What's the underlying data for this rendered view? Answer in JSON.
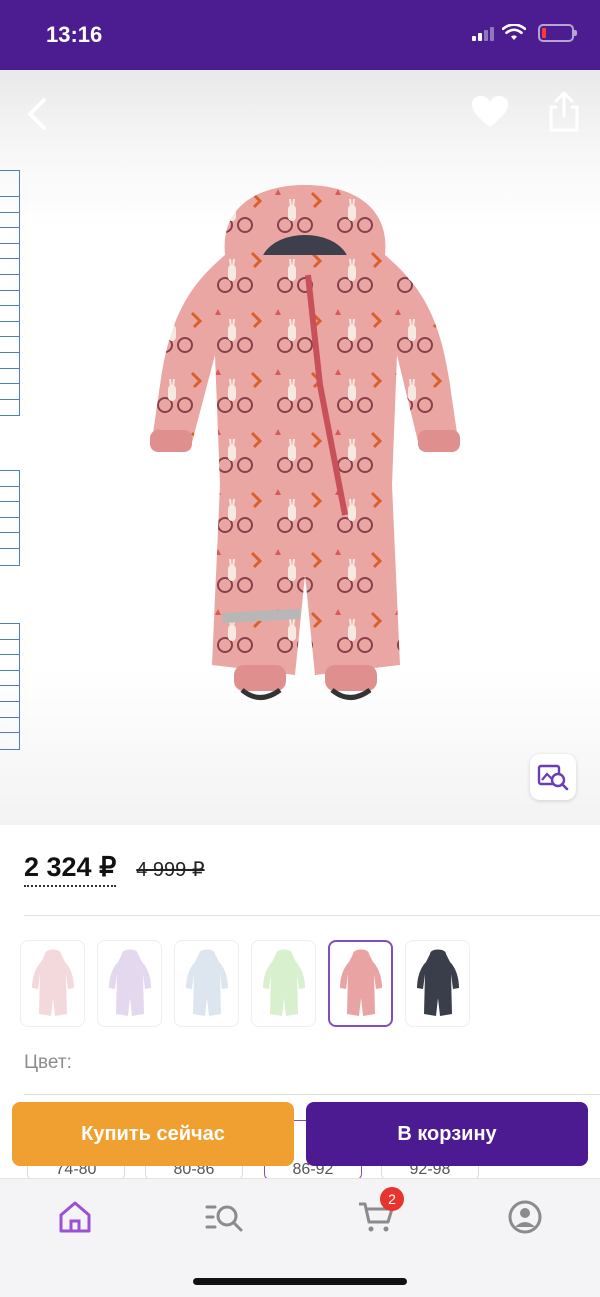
{
  "status_bar": {
    "time": "13:16",
    "icons": [
      "signal-icon",
      "wifi-icon",
      "battery-low-icon"
    ]
  },
  "header": {
    "icons": [
      "back-chevron-icon",
      "heart-icon",
      "share-icon"
    ]
  },
  "product": {
    "price_current": "2 324 ₽",
    "price_old": "4 999 ₽",
    "color_label": "Цвет:",
    "color_variants": [
      {
        "name": "light-pink",
        "color": "#f4d9dc"
      },
      {
        "name": "lilac",
        "color": "#e4d8ee"
      },
      {
        "name": "light-blue",
        "color": "#dde6ee"
      },
      {
        "name": "mint-green",
        "color": "#d9f0cf"
      },
      {
        "name": "coral-pink",
        "color": "#e9a3a3",
        "selected": true
      },
      {
        "name": "dark-navy",
        "color": "#3a3e4a"
      }
    ],
    "sizes": [
      {
        "label": "74-80"
      },
      {
        "label": "80-86"
      },
      {
        "label": "86-92",
        "selected": true,
        "big": "8"
      },
      {
        "label": "92-98"
      }
    ]
  },
  "actions": {
    "buy_now": "Купить сейчас",
    "add_to_cart": "В корзину"
  },
  "tab_bar": {
    "cart_badge": "2",
    "icons": [
      "home-icon",
      "catalog-search-icon",
      "cart-icon",
      "profile-icon"
    ]
  },
  "colors": {
    "brand": "#4c1b91",
    "accent": "#f0a030",
    "badge": "#e8332f",
    "active_tab": "#9b50d8"
  }
}
